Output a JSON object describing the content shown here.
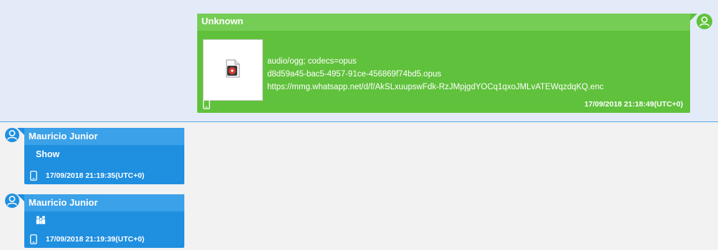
{
  "messages": [
    {
      "sender": "Unknown",
      "attachment": {
        "icon": "audio-file-icon",
        "mime": "audio/ogg; codecs=opus",
        "filename": "d8d59a45-bac5-4957-91ce-456869f74bd5.opus",
        "url": "https://mmg.whatsapp.net/d/f/AkSLxuupswFdk-RzJMpjgdYOCq1qxoJMLvATEWqzdqKQ.enc"
      },
      "timestamp": "17/09/2018 21:18:49(UTC+0)"
    },
    {
      "sender": "Mauricio Junior",
      "text": "Show",
      "timestamp": "17/09/2018 21:19:35(UTC+0)"
    },
    {
      "sender": "Mauricio Junior",
      "emoji": "family-icon",
      "timestamp": "17/09/2018 21:19:39(UTC+0)"
    }
  ],
  "colors": {
    "outgoing_bubble": "#60c13c",
    "outgoing_header": "#76cd56",
    "incoming_bubble": "#1f8fe0",
    "incoming_header": "#3ba1e8",
    "outgoing_row_bg": "#e3ebf8",
    "thread_bg": "#f2f2f2"
  }
}
